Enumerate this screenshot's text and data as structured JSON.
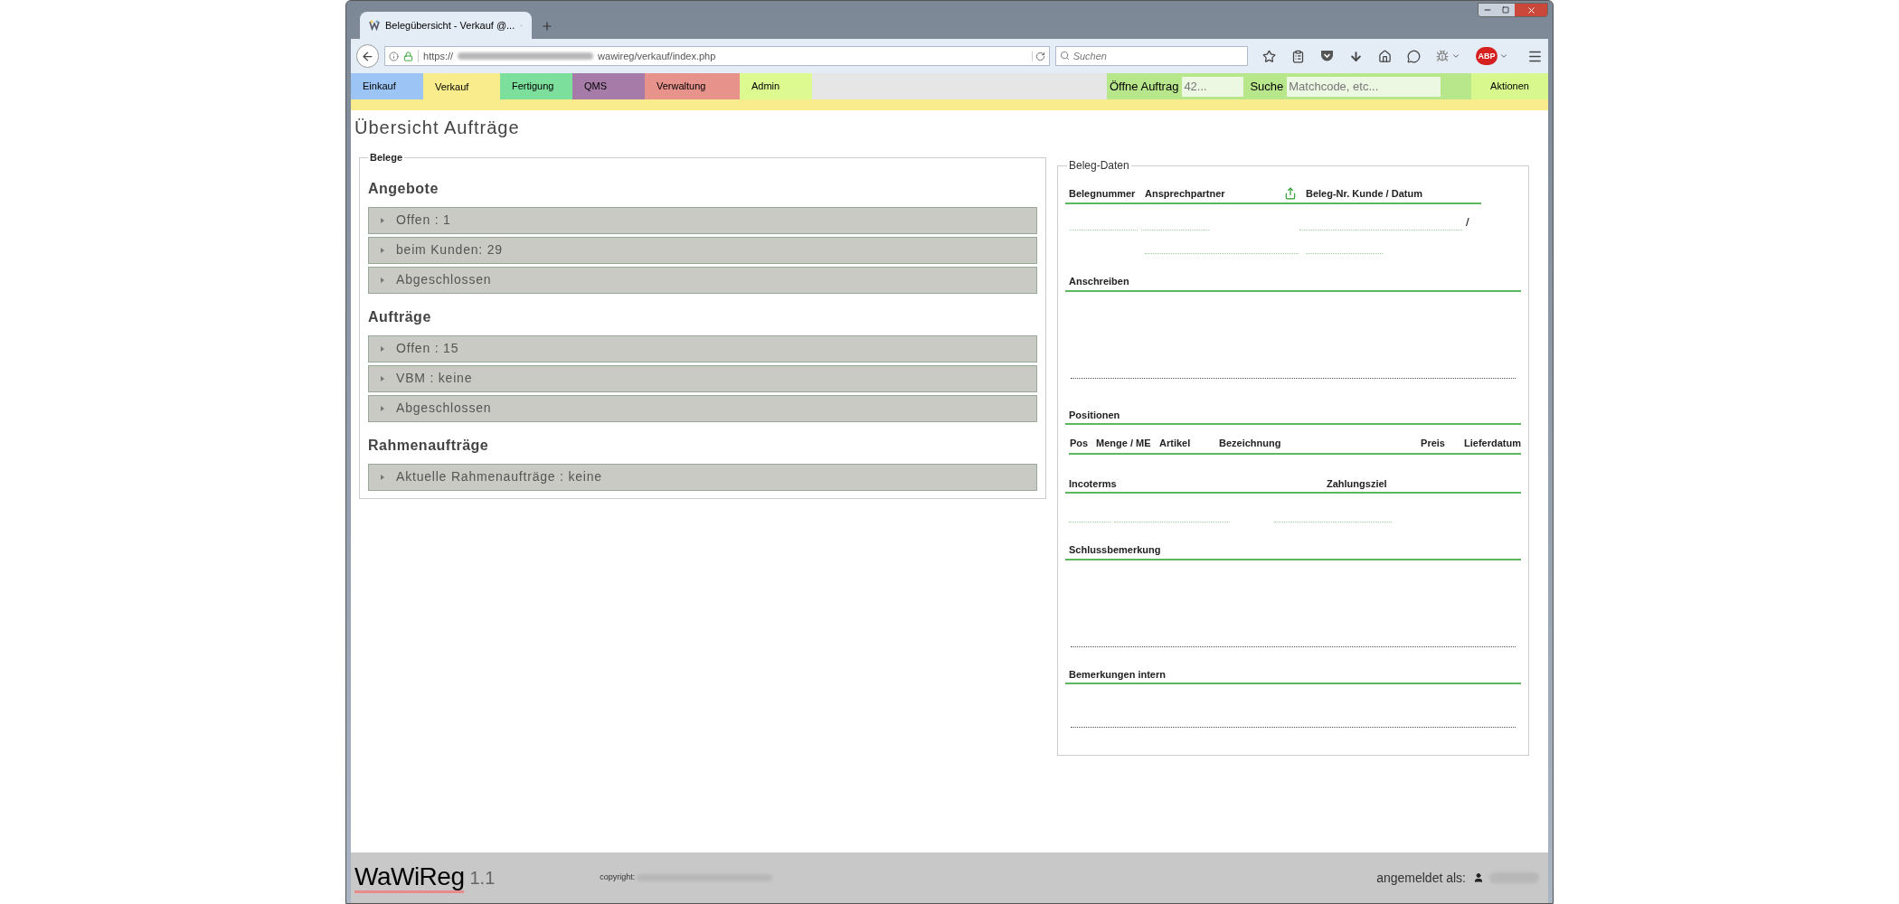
{
  "browser": {
    "tab_title": "Belegübersicht - Verkauf @...",
    "url_scheme": "https://",
    "url_path": "wawireg/verkauf/index.php",
    "search_placeholder": "Suchen",
    "adblock_label": "ABP"
  },
  "menu": {
    "tabs": [
      {
        "label": "Einkauf",
        "color": "#9cc5f6",
        "selected": false
      },
      {
        "label": "Verkauf",
        "color": "#f8ec8c",
        "selected": true
      },
      {
        "label": "Fertigung",
        "color": "#7ddf9c",
        "selected": false
      },
      {
        "label": "QMS",
        "color": "#a67ba8",
        "selected": false
      },
      {
        "label": "Verwaltung",
        "color": "#e8928c",
        "selected": false
      },
      {
        "label": "Admin",
        "color": "#dcfa90",
        "selected": false
      }
    ],
    "order_label": "Öffne Auftrag",
    "order_placeholder": "42...",
    "search_label": "Suche",
    "search_placeholder": "Matchcode, etc...",
    "actions": "Aktionen"
  },
  "page_title": "Übersicht Aufträge",
  "belege": {
    "legend": "Belege",
    "groups": [
      {
        "title": "Angebote",
        "items": [
          {
            "label": "Offen : 1",
            "expanded": false
          },
          {
            "label": "beim Kunden: 29",
            "expanded": false
          },
          {
            "label": "Abgeschlossen",
            "expanded": false
          }
        ]
      },
      {
        "title": "Aufträge",
        "items": [
          {
            "label": "Offen : 15",
            "expanded": false
          },
          {
            "label": "VBM : keine",
            "expanded": false
          },
          {
            "label": "Abgeschlossen",
            "expanded": false
          }
        ]
      },
      {
        "title": "Rahmenaufträge",
        "items": [
          {
            "label": "Aktuelle Rahmenaufträge : keine",
            "expanded": false
          }
        ]
      }
    ]
  },
  "beleg_daten": {
    "legend": "Beleg-Daten",
    "header_columns": [
      "Belegnummer",
      "Ansprechpartner",
      "Beleg-Nr. Kunde / Datum"
    ],
    "date_separator": "/",
    "sections": [
      {
        "kind": "large_text",
        "title": "Anschreiben"
      },
      {
        "kind": "table",
        "title": "Positionen",
        "columns": [
          "Pos",
          "Menge / ME",
          "Artikel",
          "Bezeichnung",
          "Preis",
          "Lieferdatum"
        ]
      },
      {
        "kind": "terms",
        "titles": [
          "Incoterms",
          "Zahlungsziel"
        ]
      },
      {
        "kind": "large_text",
        "title": "Schlussbemerkung"
      },
      {
        "kind": "small_text",
        "title": "Bemerkungen intern"
      }
    ]
  },
  "footer": {
    "logo": "WaWiReg",
    "version": "1.1",
    "copyright_label": "copyright:",
    "user_label": "angemeldet als:"
  }
}
